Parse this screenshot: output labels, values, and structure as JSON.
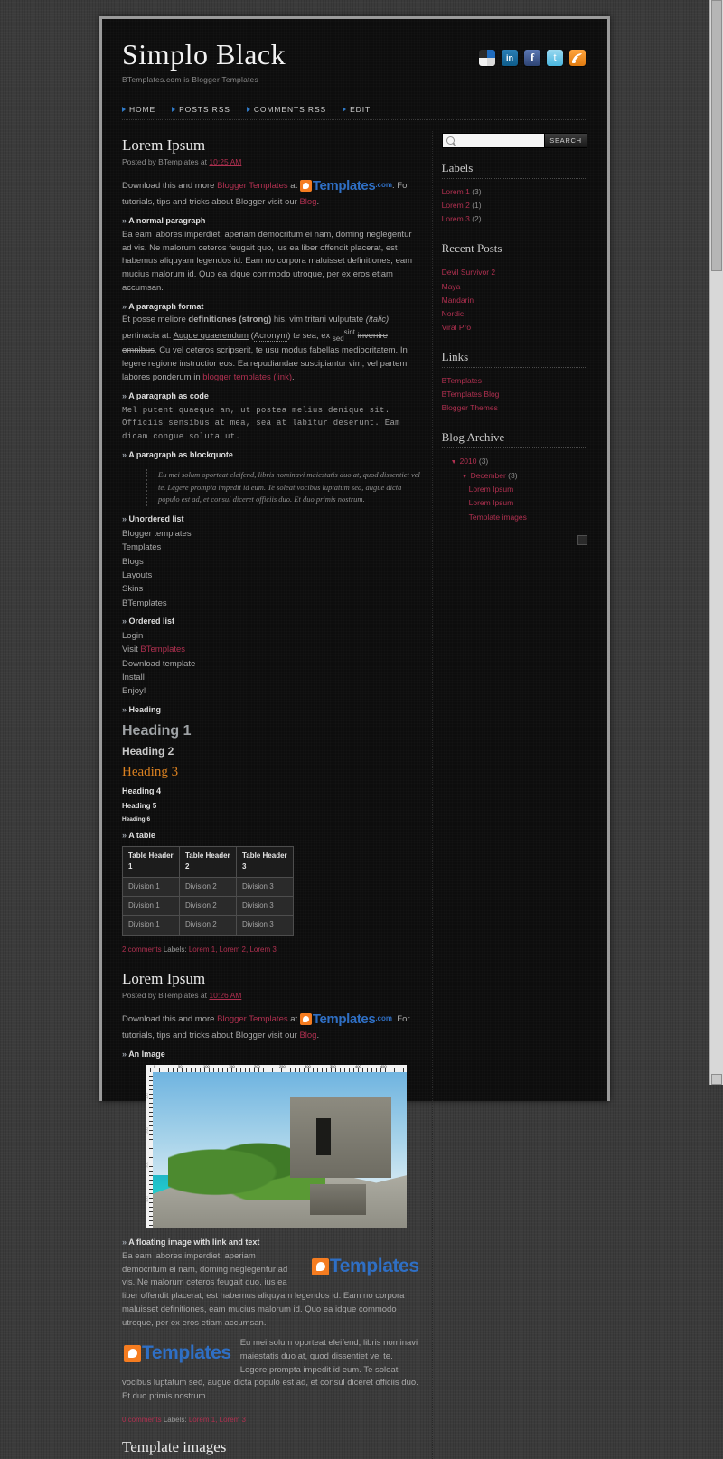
{
  "site": {
    "title": "Simplo Black",
    "description": "BTemplates.com is Blogger Templates"
  },
  "social_icons": [
    {
      "name": "delicious-icon",
      "label": "Delicious"
    },
    {
      "name": "linkedin-icon",
      "label": "in"
    },
    {
      "name": "facebook-icon",
      "label": "f"
    },
    {
      "name": "twitter-icon",
      "label": "t"
    },
    {
      "name": "rss-icon",
      "label": "RSS"
    }
  ],
  "nav": [
    {
      "label": "HOME"
    },
    {
      "label": "POSTS RSS"
    },
    {
      "label": "COMMENTS RSS"
    },
    {
      "label": "EDIT"
    }
  ],
  "posts": [
    {
      "title": "Lorem Ipsum",
      "meta_prefix": "Posted by BTemplates at",
      "meta_time": "10:25 AM",
      "intro_a": "Download this and more",
      "intro_link1": "Blogger Templates",
      "intro_at": "at",
      "logo_text": "Templates",
      "logo_com": ".com",
      "intro_b": ". For tutorials, tips and tricks about Blogger visit our",
      "intro_link2": "Blog",
      "intro_end": ".",
      "sec_normal": "A normal paragraph",
      "normal_text": "Ea eam labores imperdiet, aperiam democritum ei nam, doming neglegentur ad vis. Ne malorum ceteros feugait quo, ius ea liber offendit placerat, est habemus aliquyam legendos id. Eam no corpora maluisset definitiones, eam mucius malorum id. Quo ea idque commodo utroque, per ex eros etiam accumsan.",
      "sec_format": "A paragraph format",
      "fmt_1": "Et posse meliore ",
      "fmt_strong": "definitiones (strong)",
      "fmt_2": " his, vim tritani vulputate ",
      "fmt_italic": "(italic)",
      "fmt_3": " pertinacia at. ",
      "fmt_underline": "Augue quaerendum",
      "fmt_4": " (",
      "fmt_acronym": "Acronym",
      "fmt_5": ") te sea, ex ",
      "fmt_sub": "sed",
      "fmt_6": " ",
      "fmt_sup": "sint",
      "fmt_strike": "invenire omnibus",
      "fmt_7": ". Cu vel ceteros scripserit, te usu modus fabellas mediocritatem. In legere regione instructior eos. Ea repudiandae suscipiantur vim, vel partem labores ponderum in ",
      "fmt_link": "blogger templates (link)",
      "fmt_8": ".",
      "sec_code": "A paragraph as code",
      "code_text": "Mel putent quaeque an, ut postea melius denique sit. Officiis sensibus at mea, sea at labitur deserunt. Eam dicam congue soluta ut.",
      "sec_quote": "A paragraph as blockquote",
      "quote_text": "Eu mei solum oporteat eleifend, libris nominavi maiestatis duo at, quod dissentiet vel te. Legere prompta impedit id eum. Te soleat vocibus luptatum sed, augue dicta populo est ad, et consul diceret officiis duo. Et duo primis nostrum.",
      "sec_ul": "Unordered list",
      "ul_items": [
        "Blogger templates",
        "Templates",
        "Blogs",
        "Layouts",
        "Skins",
        "BTemplates"
      ],
      "sec_ol": "Ordered list",
      "ol_items": [
        "Login",
        "Visit BTemplates",
        "Download template",
        "Install",
        "Enjoy!"
      ],
      "ol_item2_prefix": "Visit ",
      "ol_item2_link": "BTemplates",
      "sec_heading": "Heading",
      "h1": "Heading 1",
      "h2": "Heading 2",
      "h3": "Heading 3",
      "h4": "Heading 4",
      "h5": "Heading 5",
      "h6": "Heading 6",
      "sec_table": "A table",
      "table": {
        "headers": [
          "Table Header 1",
          "Table Header 2",
          "Table Header 3"
        ],
        "rows": [
          [
            "Division 1",
            "Division 2",
            "Division 3"
          ],
          [
            "Division 1",
            "Division 2",
            "Division 3"
          ],
          [
            "Division 1",
            "Division 2",
            "Division 3"
          ]
        ]
      },
      "foot_comments": "2 comments",
      "foot_labels_word": "Labels:",
      "foot_labels": [
        "Lorem 1",
        "Lorem 2",
        "Lorem 3"
      ]
    },
    {
      "title": "Lorem Ipsum",
      "meta_prefix": "Posted by BTemplates at",
      "meta_time": "10:26 AM",
      "intro_a": "Download this and more",
      "intro_link1": "Blogger Templates",
      "intro_at": "at",
      "logo_text": "Templates",
      "logo_com": ".com",
      "intro_b": ". For tutorials, tips and tricks about Blogger visit our",
      "intro_link2": "Blog",
      "intro_end": ".",
      "sec_image": "An Image",
      "image_alt": "Mayan ruins on a cliff above turquoise sea, with ruler overlay",
      "ruler_ticks": [
        "0",
        "50",
        "100",
        "150",
        "200",
        "250",
        "300",
        "350",
        "400",
        "450"
      ],
      "ruler_ticks_v": [
        "100",
        "200",
        "300",
        "400"
      ],
      "sec_float": "A floating image with link and text",
      "float_text_1": "Ea eam labores imperdiet, aperiam democritum ei nam, doming neglegentur ad vis. Ne malorum ceteros feugait quo, ius ea liber offendit placerat, est habemus aliquyam legendos id. Eam no corpora maluisset definitiones, eam mucius malorum id. Quo ea idque commodo utroque, per ex eros etiam accumsan.",
      "float_text_2": "Eu mei solum oporteat eleifend, libris nominavi maiestatis duo at, quod dissentiet vel te. Legere prompta impedit id eum. Te soleat vocibus luptatum sed, augue dicta populo est ad, et consul diceret officiis duo. Et duo primis nostrum.",
      "logo_float_text": "Templates",
      "foot_comments": "0 comments",
      "foot_labels_word": "Labels:",
      "foot_labels": [
        "Lorem 1",
        "Lorem 3"
      ]
    },
    {
      "title": "Template images"
    }
  ],
  "sidebar": {
    "search": {
      "placeholder": "",
      "value": "",
      "button": "SEARCH"
    },
    "labels": {
      "title": "Labels",
      "items": [
        {
          "label": "Lorem 1",
          "count": "(3)"
        },
        {
          "label": "Lorem 2",
          "count": "(1)"
        },
        {
          "label": "Lorem 3",
          "count": "(2)"
        }
      ]
    },
    "recent_posts": {
      "title": "Recent Posts",
      "items": [
        "Devil Survivor 2",
        "Maya",
        "Mandarin",
        "Nordic",
        "Viral Pro"
      ]
    },
    "links": {
      "title": "Links",
      "items": [
        "BTemplates",
        "BTemplates Blog",
        "Blogger Themes"
      ]
    },
    "archive": {
      "title": "Blog Archive",
      "year": "2010",
      "year_count": "(3)",
      "month": "December",
      "month_count": "(3)",
      "posts": [
        "Lorem Ipsum",
        "Lorem Ipsum",
        "Template images"
      ]
    }
  },
  "colors": {
    "accent_link": "#b03050",
    "heading3": "#d98020",
    "logo_blue": "#2f6fc4",
    "logo_orange": "#f57c20",
    "page_bg": "#3b3b3b",
    "content_bg": "#0d0d0d"
  }
}
